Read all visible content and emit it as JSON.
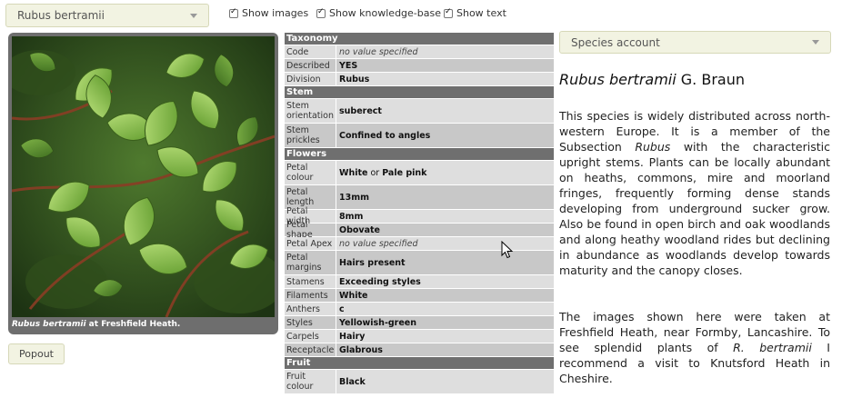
{
  "top": {
    "species_select": "Rubus bertramii",
    "show_images": "Show images",
    "show_kb": "Show knowledge-base",
    "show_text": "Show text",
    "account_select": "Species account"
  },
  "image": {
    "caption_name": "Rubus bertramii",
    "caption_rest": " at Freshfield Heath.",
    "popout": "Popout"
  },
  "kb": {
    "sections": [
      {
        "title": "Taxonomy",
        "rows": [
          {
            "key": "Code",
            "val": "no value specified",
            "nv": true
          },
          {
            "key": "Described",
            "val": "YES"
          },
          {
            "key": "Division",
            "val": "Rubus"
          }
        ]
      },
      {
        "title": "Stem",
        "rows": [
          {
            "key": "Stem orientation",
            "val": "suberect"
          },
          {
            "key": "Stem prickles",
            "val": "Confined to angles"
          }
        ]
      },
      {
        "title": "Flowers",
        "rows": [
          {
            "key": "Petal colour",
            "val": "White",
            "or": "or",
            "val2": "Pale pink"
          },
          {
            "key": "Petal length",
            "val": "13mm"
          },
          {
            "key": "Petal width",
            "val": "8mm"
          },
          {
            "key": "Petal shape",
            "val": "Obovate"
          },
          {
            "key": "Petal Apex",
            "val": "no value specified",
            "nv": true
          },
          {
            "key": "Petal margins",
            "val": "Hairs present"
          },
          {
            "key": "Stamens",
            "val": "Exceeding styles"
          },
          {
            "key": "Filaments",
            "val": "White"
          },
          {
            "key": "Anthers",
            "val": "c"
          },
          {
            "key": "Styles",
            "val": "Yellowish-green"
          },
          {
            "key": "Carpels",
            "val": "Hairy"
          },
          {
            "key": "Receptacle",
            "val": "Glabrous"
          }
        ]
      },
      {
        "title": "Fruit",
        "rows": [
          {
            "key": "Fruit colour",
            "val": "Black"
          }
        ]
      }
    ]
  },
  "account": {
    "title_name": "Rubus bertramii",
    "title_author": " G. Braun",
    "p1_a": "This species is widely distributed across north-western Europe. It is a member of the Subsection ",
    "p1_i": "Rubus",
    "p1_b": " with the characteristic upright stems. Plants can be locally abundant on heaths, commons, mire and moorland fringes, frequently forming dense stands developing from underground sucker grow. Also be found in open birch and oak woodlands and along heathy woodland rides but declining in abundance as woodlands develop towards maturity and the canopy closes.",
    "p2_a": "The images shown here were taken at Freshfield Heath, near Formby, Lancashire. To see splendid plants of ",
    "p2_i": "R. bertramii",
    "p2_b": " I recommend a visit to Knutsford Heath in Cheshire."
  }
}
